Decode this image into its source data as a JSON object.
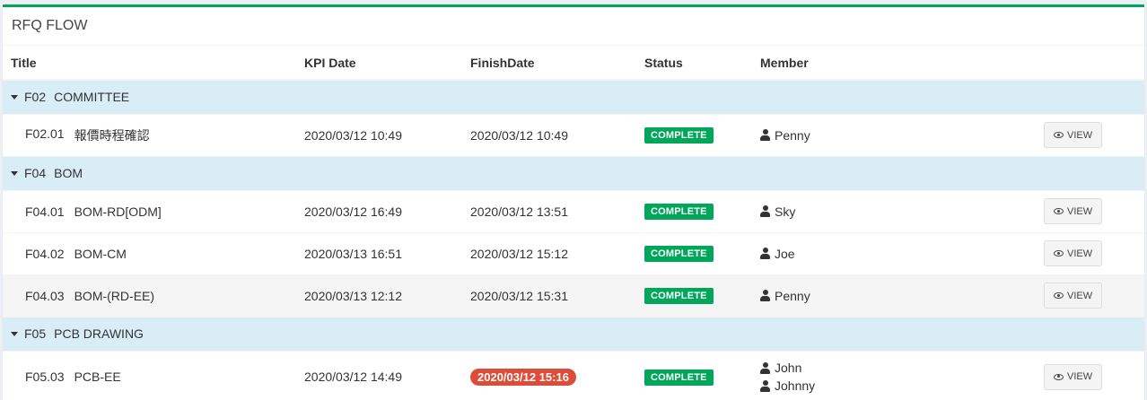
{
  "box": {
    "title": "RFQ FLOW"
  },
  "columns": {
    "title": "Title",
    "kpi_date": "KPI Date",
    "finish_date": "FinishDate",
    "status": "Status",
    "member": "Member"
  },
  "colors": {
    "accent": "#00a65a",
    "group_bg": "#d9edf7",
    "overdue": "#dd4b39"
  },
  "groups": [
    {
      "code": "F02",
      "name": "COMMITTEE",
      "items": [
        {
          "code": "F02.01",
          "name": "報價時程確認",
          "kpi_date": "2020/03/12 10:49",
          "finish_date": "2020/03/12 10:49",
          "finish_overdue": false,
          "status": "COMPLETE",
          "members": [
            "Penny"
          ],
          "action": "VIEW",
          "striped": false
        }
      ]
    },
    {
      "code": "F04",
      "name": "BOM",
      "items": [
        {
          "code": "F04.01",
          "name": "BOM-RD[ODM]",
          "kpi_date": "2020/03/12 16:49",
          "finish_date": "2020/03/12 13:51",
          "finish_overdue": false,
          "status": "COMPLETE",
          "members": [
            "Sky"
          ],
          "action": "VIEW",
          "striped": false
        },
        {
          "code": "F04.02",
          "name": "BOM-CM",
          "kpi_date": "2020/03/13 16:51",
          "finish_date": "2020/03/12 15:12",
          "finish_overdue": false,
          "status": "COMPLETE",
          "members": [
            "Joe"
          ],
          "action": "VIEW",
          "striped": false
        },
        {
          "code": "F04.03",
          "name": "BOM-(RD-EE)",
          "kpi_date": "2020/03/13 12:12",
          "finish_date": "2020/03/12 15:31",
          "finish_overdue": false,
          "status": "COMPLETE",
          "members": [
            "Penny"
          ],
          "action": "VIEW",
          "striped": true
        }
      ]
    },
    {
      "code": "F05",
      "name": "PCB DRAWING",
      "items": [
        {
          "code": "F05.03",
          "name": "PCB-EE",
          "kpi_date": "2020/03/12 14:49",
          "finish_date": "2020/03/12 15:16",
          "finish_overdue": true,
          "status": "COMPLETE",
          "members": [
            "John",
            "Johnny"
          ],
          "action": "VIEW",
          "striped": false
        }
      ]
    }
  ]
}
